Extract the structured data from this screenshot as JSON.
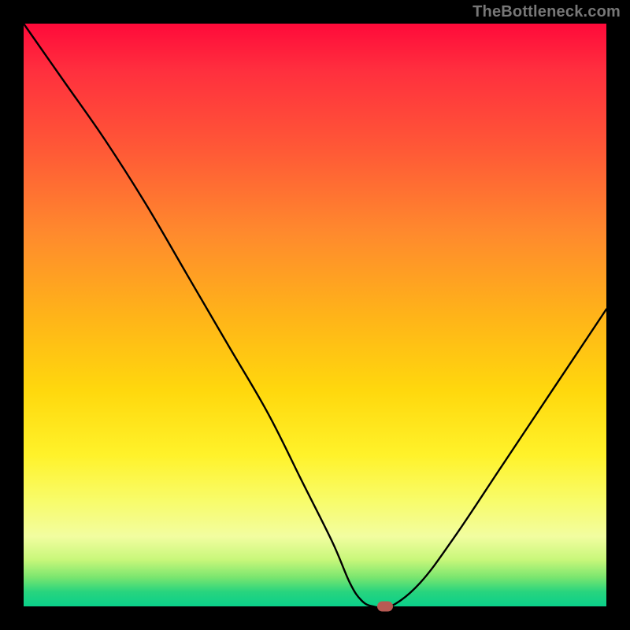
{
  "watermark": "TheBottleneck.com",
  "colors": {
    "page_bg": "#000000",
    "curve_stroke": "#000000",
    "marker_fill": "#b85a53",
    "watermark_text": "#777777"
  },
  "chart_data": {
    "type": "line",
    "title": "",
    "xlabel": "",
    "ylabel": "",
    "xlim": [
      0,
      100
    ],
    "ylim": [
      0,
      100
    ],
    "grid": false,
    "series": [
      {
        "name": "bottleneck-curve",
        "x": [
          0,
          7,
          14,
          21,
          28,
          35,
          42,
          48,
          53,
          56,
          58,
          60,
          63,
          68,
          74,
          82,
          90,
          100
        ],
        "values": [
          100,
          90,
          80,
          69,
          57,
          45,
          33,
          21,
          11,
          4,
          1,
          0,
          0,
          4,
          12,
          24,
          36,
          51
        ]
      }
    ],
    "marker": {
      "x": 62,
      "y": 0
    },
    "background_gradient_meaning": "percentage bottleneck: top=high (red), bottom=low (green)"
  }
}
